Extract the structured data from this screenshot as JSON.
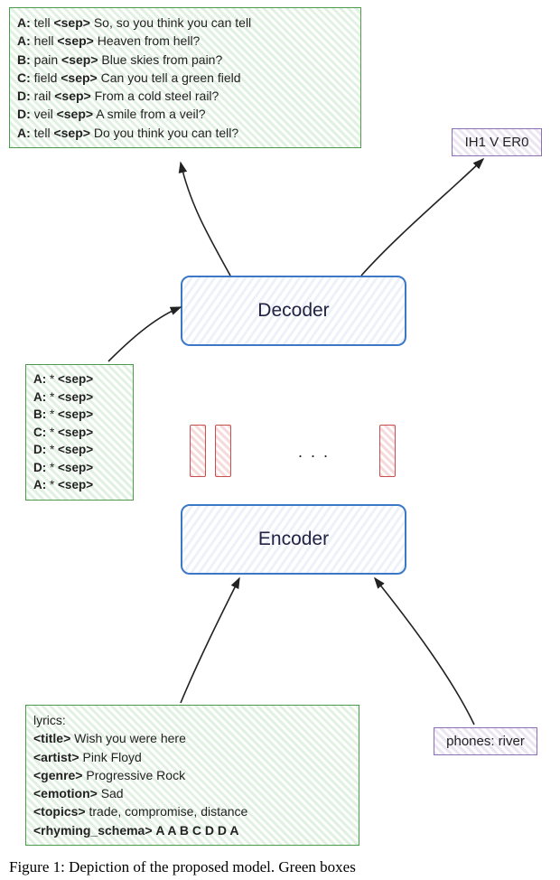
{
  "output_lyrics": {
    "lines": [
      {
        "label": "A:",
        "word": "tell",
        "sep": "<sep>",
        "rest": "So, so you think you can tell"
      },
      {
        "label": "A:",
        "word": "hell",
        "sep": "<sep>",
        "rest": "Heaven from hell?"
      },
      {
        "label": "B:",
        "word": "pain",
        "sep": "<sep>",
        "rest": "Blue skies from pain?"
      },
      {
        "label": "C:",
        "word": "field",
        "sep": "<sep>",
        "rest": "Can you tell a green field"
      },
      {
        "label": "D:",
        "word": "rail",
        "sep": "<sep>",
        "rest": "From a cold steel rail?"
      },
      {
        "label": "D:",
        "word": "veil",
        "sep": "<sep>",
        "rest": "A smile from a veil?"
      },
      {
        "label": "A:",
        "word": "tell",
        "sep": "<sep>",
        "rest": "Do you think you can tell?"
      }
    ]
  },
  "output_phones": {
    "text": "IH1 V ER0"
  },
  "decoder": {
    "label": "Decoder"
  },
  "encoder": {
    "label": "Encoder"
  },
  "decoder_prompt": {
    "lines": [
      {
        "label": "A:",
        "word": "*",
        "sep": "<sep>"
      },
      {
        "label": "A:",
        "word": "*",
        "sep": "<sep>"
      },
      {
        "label": "B:",
        "word": "*",
        "sep": "<sep>"
      },
      {
        "label": "C:",
        "word": "*",
        "sep": "<sep>"
      },
      {
        "label": "D:",
        "word": "*",
        "sep": "<sep>"
      },
      {
        "label": "D:",
        "word": "*",
        "sep": "<sep>"
      },
      {
        "label": "A:",
        "word": "*",
        "sep": "<sep>"
      }
    ]
  },
  "encoder_lyrics_input": {
    "header": "lyrics:",
    "title_tag": "<title>",
    "title_val": "Wish you were here",
    "artist_tag": "<artist>",
    "artist_val": "Pink Floyd",
    "genre_tag": "<genre>",
    "genre_val": "Progressive Rock",
    "emotion_tag": "<emotion>",
    "emotion_val": "Sad",
    "topics_tag": "<topics>",
    "topics_val": "trade, compromise, distance",
    "schema_tag": "<rhyming_schema>",
    "schema_val": "A A B C D D A"
  },
  "encoder_phones_input": {
    "text": "phones: river"
  },
  "caption": {
    "text": "Figure 1: Depiction of the proposed model. Green boxes"
  }
}
